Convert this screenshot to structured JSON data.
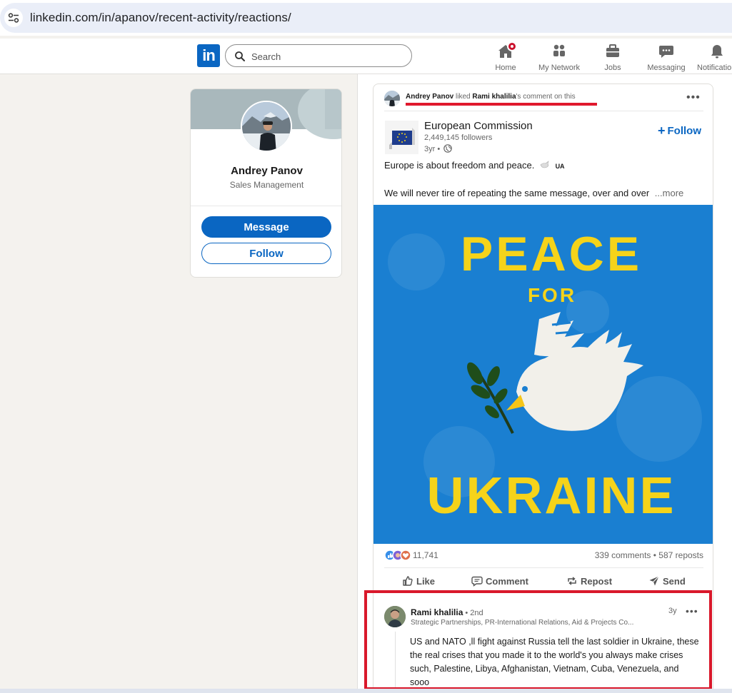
{
  "browser": {
    "url": "linkedin.com/in/apanov/recent-activity/reactions/"
  },
  "nav": {
    "search_placeholder": "Search",
    "items": [
      {
        "label": "Home",
        "icon": "home-icon"
      },
      {
        "label": "My Network",
        "icon": "people-icon"
      },
      {
        "label": "Jobs",
        "icon": "briefcase-icon"
      },
      {
        "label": "Messaging",
        "icon": "chat-icon"
      },
      {
        "label": "Notifications",
        "icon": "bell-icon"
      }
    ],
    "logo_text": "in",
    "brand_color": "#0a66c2",
    "badge_color": "#cb112d"
  },
  "profile": {
    "name": "Andrey Panov",
    "headline": "Sales Management",
    "message_label": "Message",
    "follow_label": "Follow"
  },
  "feed": {
    "activity": {
      "actor": "Andrey Panov",
      "verb": " liked ",
      "target": "Rami khalilia",
      "suffix": "'s comment on this"
    },
    "post": {
      "author": "European Commission",
      "followers": "2,449,145 followers",
      "age": "3yr •",
      "follow_label": "Follow",
      "text_line_1": "Europe is about freedom and peace.",
      "ua_tag": "UA",
      "text_line_2": "We will never tire of repeating the same message, over and over",
      "more_label": "...more",
      "image": {
        "line_1": "PEACE",
        "line_2": "FOR",
        "line_3": "UKRAINE",
        "bg_color": "#1a7fd1",
        "text_color": "#f5d31a"
      },
      "reactions_count": "11,741",
      "comments_reposts": "339 comments • 587 reposts",
      "actions": {
        "like": "Like",
        "comment": "Comment",
        "repost": "Repost",
        "send": "Send"
      }
    },
    "comment": {
      "author": "Rami khalilia",
      "degree": "• 2nd",
      "title": "Strategic Partnerships, PR-International Relations, Aid & Projects Co...",
      "time": "3y",
      "text": "US and NATO ,ll fight against Russia tell the last soldier in Ukraine, these the real crises that you made it to the world's you always make crises such, Palestine, Libya, Afghanistan, Vietnam, Cuba, Venezuela, and sooo"
    }
  },
  "highlight_color": "#d9182b"
}
